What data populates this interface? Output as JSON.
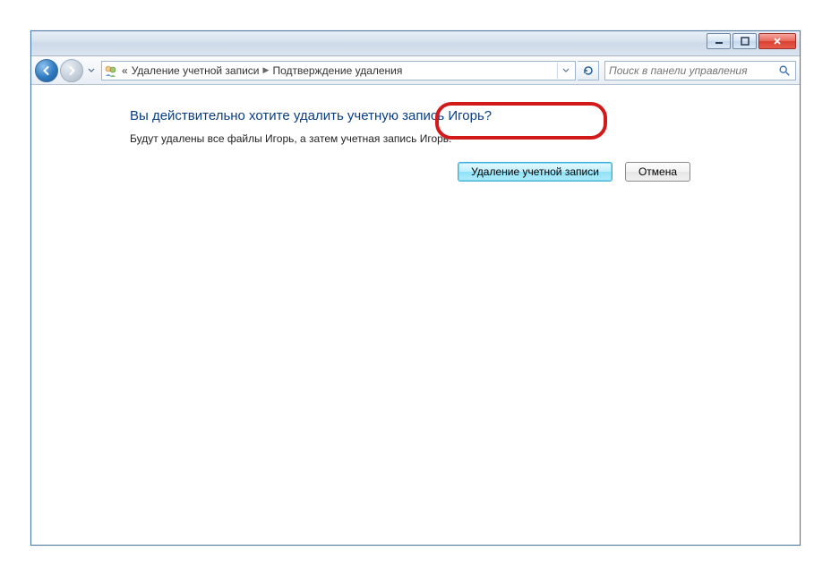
{
  "breadcrumb": {
    "prefix": "«",
    "item1": "Удаление учетной записи",
    "item2": "Подтверждение удаления"
  },
  "search": {
    "placeholder": "Поиск в панели управления"
  },
  "main": {
    "heading": "Вы действительно хотите удалить учетную запись Игорь?",
    "description": "Будут удалены все файлы Игорь, а затем учетная запись Игорь."
  },
  "buttons": {
    "delete": "Удаление учетной записи",
    "cancel": "Отмена"
  }
}
